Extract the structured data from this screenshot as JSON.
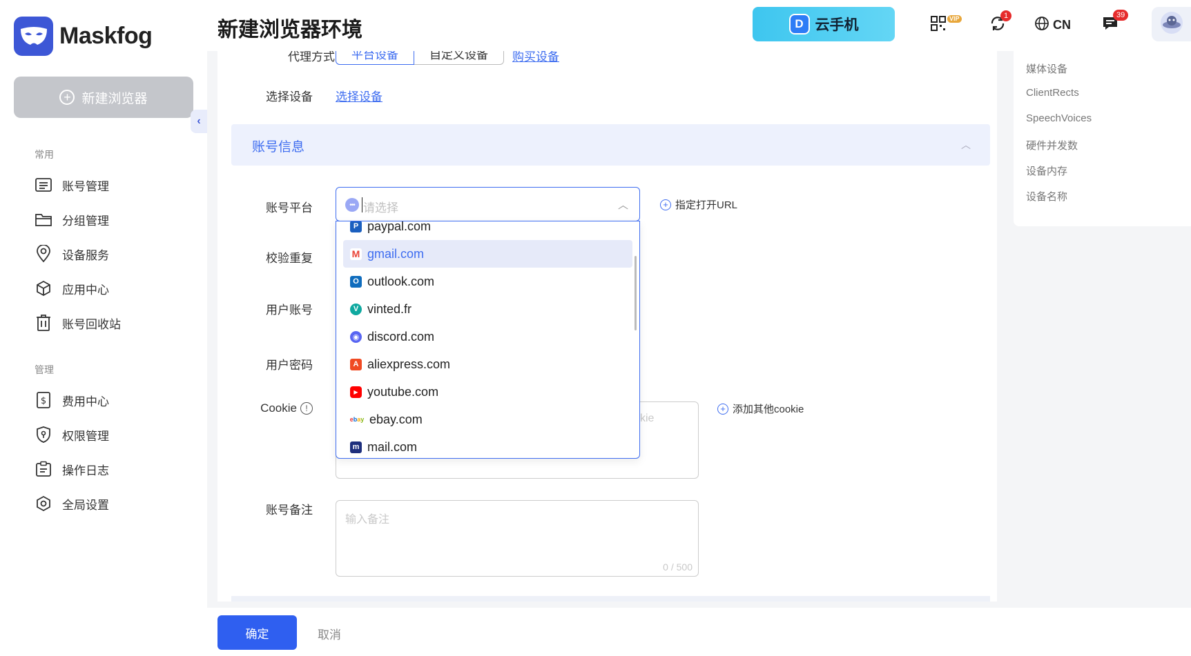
{
  "app": {
    "name": "Maskfog",
    "new_browser_label": "新建浏览器"
  },
  "sidebar": {
    "section_common": "常用",
    "common_items": [
      {
        "label": "账号管理",
        "icon": "account-list-icon"
      },
      {
        "label": "分组管理",
        "icon": "folder-icon"
      },
      {
        "label": "设备服务",
        "icon": "location-pin-icon"
      },
      {
        "label": "应用中心",
        "icon": "cube-icon"
      },
      {
        "label": "账号回收站",
        "icon": "trash-icon"
      }
    ],
    "section_manage": "管理",
    "manage_items": [
      {
        "label": "费用中心",
        "icon": "dollar-doc-icon"
      },
      {
        "label": "权限管理",
        "icon": "shield-key-icon"
      },
      {
        "label": "操作日志",
        "icon": "clipboard-icon"
      },
      {
        "label": "全局设置",
        "icon": "settings-hex-icon"
      }
    ]
  },
  "header": {
    "title": "新建浏览器环境",
    "cloud_phone_label": "云手机",
    "vip_label": "VIP",
    "sync_badge": "1",
    "language": "CN",
    "messages_badge": "39"
  },
  "form": {
    "proxy_label": "代理方式",
    "proxy_tabs": [
      "平台设备",
      "自定义设备"
    ],
    "buy_device_link": "购买设备",
    "select_device_label": "选择设备",
    "select_device_link": "选择设备",
    "account_section_title": "账号信息",
    "platform_label": "账号平台",
    "platform_placeholder": "请选择",
    "open_url_label": "指定打开URL",
    "check_duplicate_label": "校验重复",
    "user_account_label": "用户账号",
    "user_password_label": "用户密码",
    "cookie_label": "Cookie",
    "cookie_placeholder_tail": "kie",
    "add_cookie_label": "添加其他cookie",
    "remark_label": "账号备注",
    "remark_placeholder": "输入备注",
    "remark_counter": "0 / 500"
  },
  "dropdown": {
    "items": [
      {
        "label": "paypal.com",
        "icon": "paypal-icon",
        "color": "#1b5fbf",
        "selected": false
      },
      {
        "label": "gmail.com",
        "icon": "gmail-icon",
        "color": "#e94235",
        "selected": true
      },
      {
        "label": "outlook.com",
        "icon": "outlook-icon",
        "color": "#0f6cbd",
        "selected": false
      },
      {
        "label": "vinted.fr",
        "icon": "vinted-icon",
        "color": "#0fa9a0",
        "selected": false
      },
      {
        "label": "discord.com",
        "icon": "discord-icon",
        "color": "#5865f2",
        "selected": false
      },
      {
        "label": "aliexpress.com",
        "icon": "aliexpress-icon",
        "color": "#f04a23",
        "selected": false
      },
      {
        "label": "youtube.com",
        "icon": "youtube-icon",
        "color": "#ff0000",
        "selected": false
      },
      {
        "label": "ebay.com",
        "icon": "ebay-icon",
        "color": "#e53238",
        "selected": false
      },
      {
        "label": "mail.com",
        "icon": "mailcom-icon",
        "color": "#1e2f7d",
        "selected": false
      }
    ]
  },
  "right_nav": {
    "items": [
      "媒体设备",
      "ClientRects",
      "SpeechVoices",
      "硬件并发数",
      "设备内存",
      "设备名称"
    ]
  },
  "footer": {
    "confirm_label": "确定",
    "cancel_label": "取消"
  },
  "colors": {
    "accent": "#3d6cf0",
    "brand": "#3d57d6",
    "badge": "#e62b2b"
  }
}
